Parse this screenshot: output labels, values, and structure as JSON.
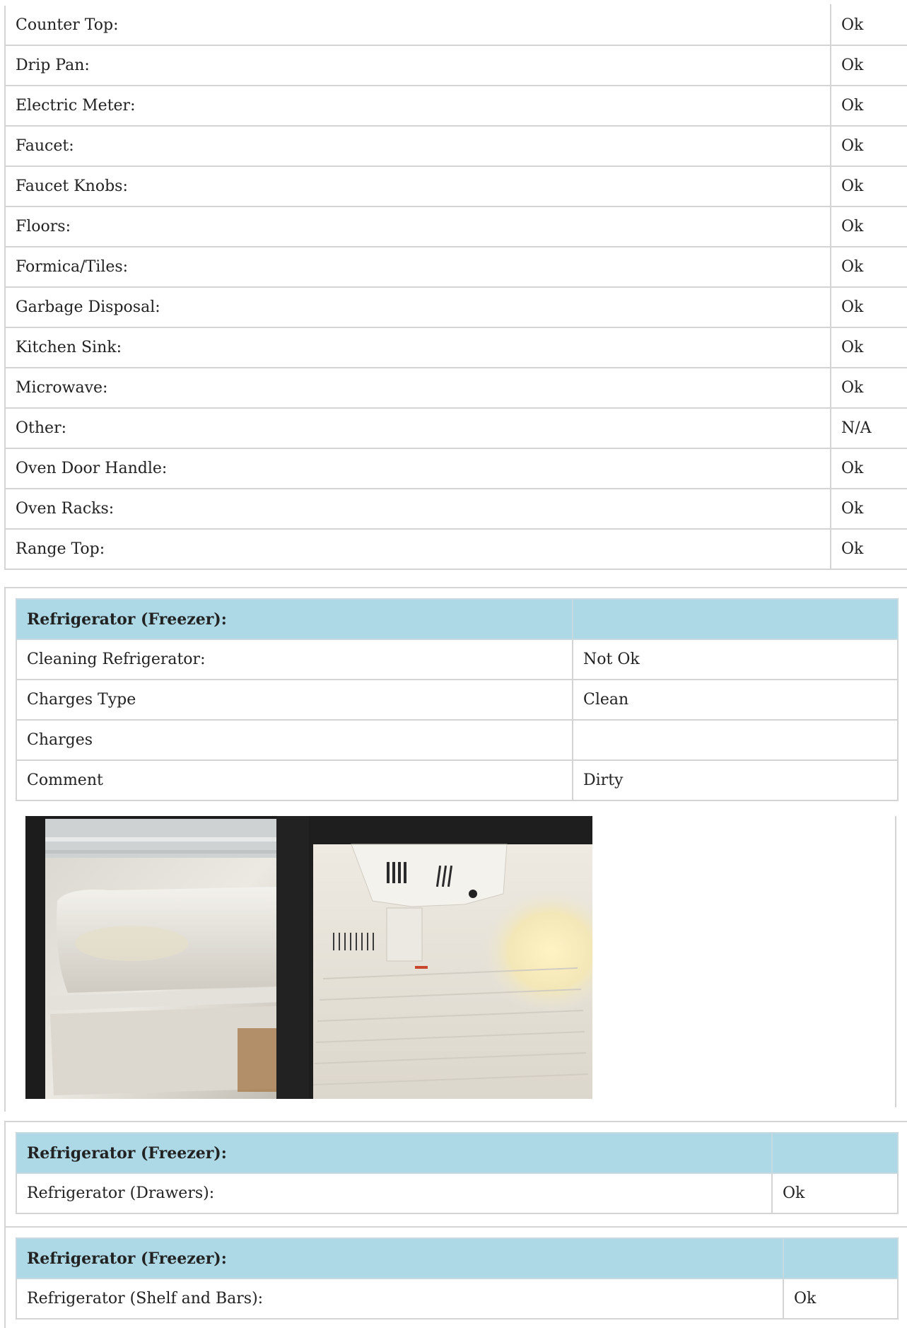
{
  "main_rows": [
    {
      "label": "Counter Top:",
      "value": "Ok"
    },
    {
      "label": "Drip Pan:",
      "value": "Ok"
    },
    {
      "label": "Electric Meter:",
      "value": "Ok"
    },
    {
      "label": "Faucet:",
      "value": "Ok"
    },
    {
      "label": "Faucet Knobs:",
      "value": "Ok"
    },
    {
      "label": "Floors:",
      "value": "Ok"
    },
    {
      "label": "Formica/Tiles:",
      "value": "Ok"
    },
    {
      "label": "Garbage Disposal:",
      "value": "Ok"
    },
    {
      "label": "Kitchen Sink:",
      "value": "Ok"
    },
    {
      "label": "Microwave:",
      "value": "Ok"
    },
    {
      "label": "Other:",
      "value": "N/A"
    },
    {
      "label": "Oven Door Handle:",
      "value": "Ok"
    },
    {
      "label": "Oven Racks:",
      "value": "Ok"
    },
    {
      "label": "Range Top:",
      "value": "Ok"
    }
  ],
  "sections": [
    {
      "header": "Refrigerator (Freezer):",
      "rows": [
        {
          "label": "Cleaning Refrigerator:",
          "value": "Not Ok"
        },
        {
          "label": "Charges Type",
          "value": "Clean"
        },
        {
          "label": "Charges",
          "value": ""
        },
        {
          "label": "Comment",
          "value": "Dirty"
        }
      ],
      "photos": [
        "fridge-door-shelves-photo",
        "freezer-interior-photo"
      ]
    },
    {
      "header": "Refrigerator (Freezer):",
      "rows": [
        {
          "label": "Refrigerator (Drawers):",
          "value": "Ok"
        }
      ]
    },
    {
      "header": "Refrigerator (Freezer):",
      "rows": [
        {
          "label": "Refrigerator (Shelf and Bars):",
          "value": "Ok"
        }
      ]
    }
  ],
  "colors": {
    "header_bg": "#add8e6",
    "border": "#d4d4d4"
  }
}
